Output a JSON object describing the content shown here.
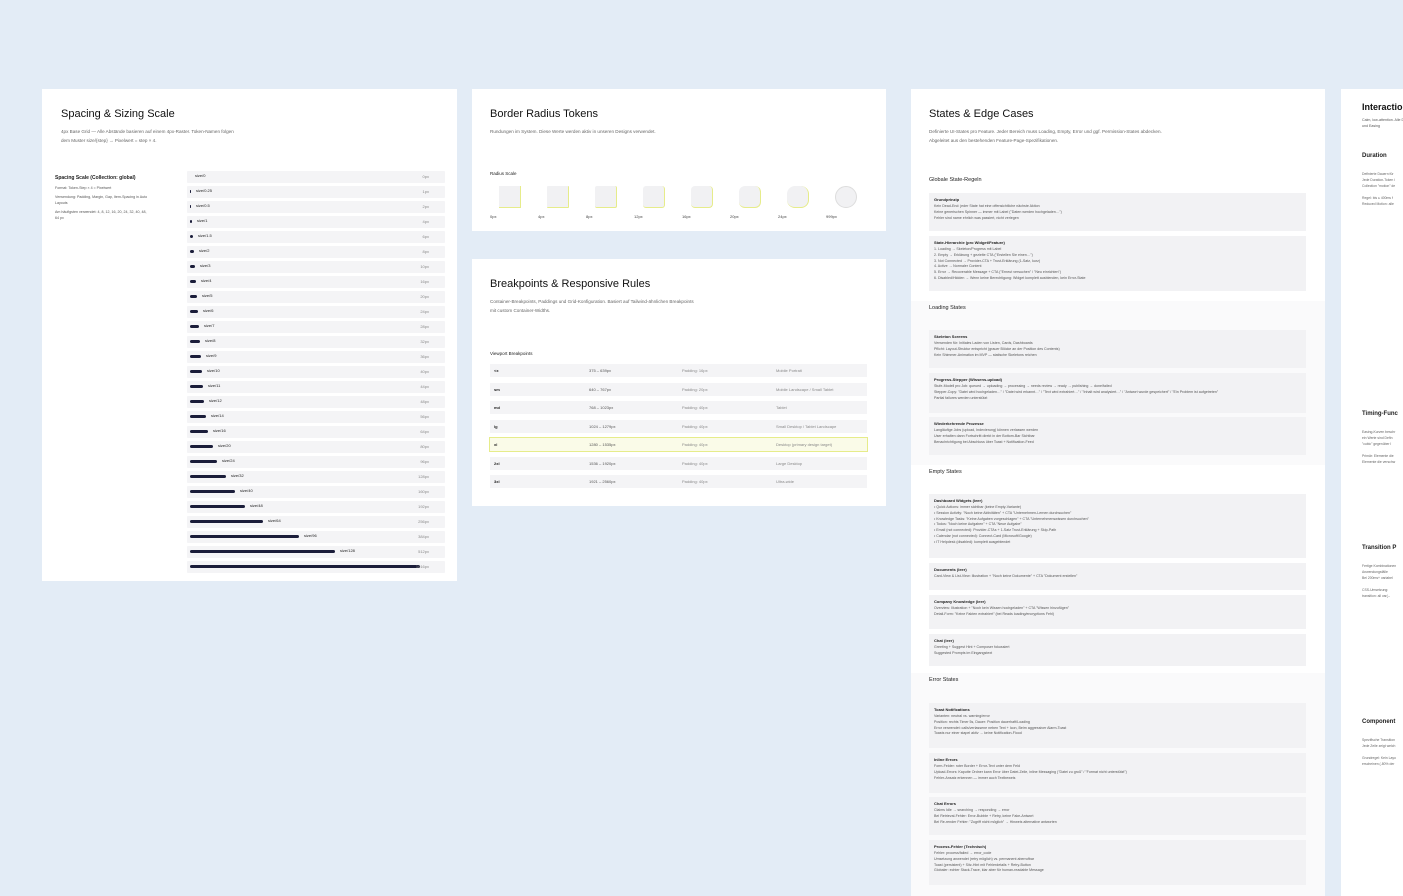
{
  "spacing": {
    "title": "Spacing & Sizing Scale",
    "desc": "4px Base Grid — Alle Abstände basieren auf einem 4px-Raster. Token-Namen folgen dem Muster size/{step} → Pixelwert = step × 4.",
    "side_title": "Spacing Scale (Collection: global)",
    "side_lines": [
      "Format: Token-Step × 4 = Pixelwert",
      "Verwendung: Padding, Margin, Gap, Item-Spacing in Auto Layouts",
      "Am häufigsten verwendet: 4, 8, 12, 16, 20, 24, 32, 40, 48, 64 px"
    ],
    "rows": [
      {
        "name": "size/0",
        "value": "0px"
      },
      {
        "name": "size/0.25",
        "value": "1px"
      },
      {
        "name": "size/0.5",
        "value": "2px"
      },
      {
        "name": "size/1",
        "value": "4px"
      },
      {
        "name": "size/1.5",
        "value": "6px"
      },
      {
        "name": "size/2",
        "value": "8px"
      },
      {
        "name": "size/3",
        "value": "10px"
      },
      {
        "name": "size/4",
        "value": "16px"
      },
      {
        "name": "size/5",
        "value": "20px"
      },
      {
        "name": "size/6",
        "value": "24px"
      },
      {
        "name": "size/7",
        "value": "28px"
      },
      {
        "name": "size/8",
        "value": "32px"
      },
      {
        "name": "size/9",
        "value": "36px"
      },
      {
        "name": "size/10",
        "value": "40px"
      },
      {
        "name": "size/11",
        "value": "44px"
      },
      {
        "name": "size/12",
        "value": "48px"
      },
      {
        "name": "size/14",
        "value": "56px"
      },
      {
        "name": "size/16",
        "value": "64px"
      },
      {
        "name": "size/20",
        "value": "80px"
      },
      {
        "name": "size/24",
        "value": "96px"
      },
      {
        "name": "size/32",
        "value": "128px"
      },
      {
        "name": "size/40",
        "value": "160px"
      },
      {
        "name": "size/48",
        "value": "192px"
      },
      {
        "name": "size/64",
        "value": "256px"
      },
      {
        "name": "size/96",
        "value": "384px"
      },
      {
        "name": "size/128",
        "value": "512px"
      },
      {
        "name": "",
        "value": "1016px"
      }
    ],
    "bar_fill": "#1b1d3a"
  },
  "radius": {
    "title": "Border Radius Tokens",
    "desc": "Rundungen im System. Diese Werte werden aktiv in unseren Designs verwendet.",
    "scale_label": "Radius Scale",
    "items": [
      {
        "label": "0px"
      },
      {
        "label": "4px"
      },
      {
        "label": "8px"
      },
      {
        "label": "12px"
      },
      {
        "label": "16px"
      },
      {
        "label": "20px"
      },
      {
        "label": "24px"
      },
      {
        "label": "999px"
      }
    ]
  },
  "breakpoints": {
    "title": "Breakpoints & Responsive Rules",
    "desc": "Container-Breakpoints, Paddings und Grid-Konfiguration. Basiert auf Tailwind-ähnlichen Breakpoints mit custom Container-Widths.",
    "table_label": "Viewport Breakpoints",
    "rows": [
      {
        "name": "<x",
        "range": "375 – 639px",
        "padding": "Padding: 16px",
        "use": "Mobile Portrait"
      },
      {
        "name": "sm",
        "range": "640 – 767px",
        "padding": "Padding: 20px",
        "use": "Mobile Landscape / Small Tablet"
      },
      {
        "name": "md",
        "range": "768 – 1023px",
        "padding": "Padding: 40px",
        "use": "Tablet"
      },
      {
        "name": "lg",
        "range": "1024 – 1279px",
        "padding": "Padding: 40px",
        "use": "Small Desktop / Tablet Landscape"
      },
      {
        "name": "xl",
        "range": "1280 – 1535px",
        "padding": "Padding: 40px",
        "use": "Desktop (primary design target)"
      },
      {
        "name": "2xl",
        "range": "1536 – 1920px",
        "padding": "Padding: 40px",
        "use": "Large Desktop"
      },
      {
        "name": "3xl",
        "range": "1921 – 2560px",
        "padding": "Padding: 40px",
        "use": "Ultra-wide"
      }
    ]
  },
  "states": {
    "title": "States & Edge Cases",
    "desc": "Definierte UI-States pro Feature. Jeder Bereich muss Loading, Empty, Error und ggf. Permission-States abdecken. Abgeleitet aus den bestehenden Feature-Page-Spezifikationen.",
    "sections": [
      {
        "title": "Globale State-Regeln",
        "blocks": [
          {
            "title": "Grundprinzip",
            "body": "Kein Dead-End: jeder State hat eine offensichtliche nächste Aktion\nKeine generischen Spinner — immer mit Label (\"Daten werden hochgeladen…\")\nFehler sind name ehrlich was passiert, nicht verlegen"
          },
          {
            "title": "State-Hierarchie (pro Widget/Feature)",
            "body": "1. Loading → Skeleton/Progress mit Label\n2. Empty → Erklärung + gezielte CTA (\"Erstellen Sie einen…\")\n3. Not Connected → Provider-CTA + Trust-Erklärung (1-Satz, kurz)\n4. Active → Normaler Content\n5. Error → Recoverable Message + CTA (\"Erneut versuchen\" / \"Neu einrichten\")\n6. Disabled/Hidden → Wenn keine Berechtigung: Widget komplett ausblenden, kein Error-State"
          }
        ]
      },
      {
        "title": "Loading States",
        "blocks": [
          {
            "title": "Skeleton Screens",
            "body": "Verwenden für: Initiales Laden von Listen, Cards, Dashboards\nPflicht: Layout-Struktur entspricht (grauer Blöcke an der Position des Contents)\nKein Shimmer-Animation im MVP — statische Skeletons reichen"
          },
          {
            "title": "Progress-Stepper (Wissens-upload)",
            "body": "Stufe-Modell pro Job: queued → uploading → processing → needs review → ready → publishing → done/failed\nStepper-Copy: \"Datei wird hochgeladen…\" / \"Datei wird erkannt…\" / \"Text wird extrahiert…\" / \"Inhalt wird analysiert…\" / \"Antwort wurde gespeichert\" / \"Ein Problem ist aufgetreten\"\nPartial failures werden unterstützt"
          },
          {
            "title": "Wiederkehrende Prozesse",
            "body": "Langläufige Jobs (upload, Indexierung) können verlassen werden\nUser erhalten dann Fortschritt direkt in der Bottom-Bar Sichtbar\nBenachrichtigung bei Abschluss über Toast + Notification-Feed"
          }
        ]
      },
      {
        "title": "Empty States",
        "blocks": [
          {
            "title": "Dashboard Widgets (leer)",
            "body": "• Quick Actions: immer sichtbar (keine Empty-Variante)\n• Session Activity: \"Noch keine Aktivitäten\" + CTA \"Unternehmen-Lernen durchsuchen\"\n• Knowledge Tasks: \"Keine Aufgaben vorgeschlagen\" + CTA \"Unternehmenswissen durchsuchen\"\n• Todos: \"Noch keine Aufgaben\" + CTA \"Neue Aufgabe\"\n• Email (not connected): Provider-CTAs + 1-Satz Trust-Erklärung + Skip-Path\n• Calendar (not connected): Connect-Card (Microsoft/Google)\n• IT Helpdesk (disabled): komplett ausgeblendet"
          },
          {
            "title": "Documents (leer)",
            "body": "Card-View & List-View: Illustration + \"Noch keine Dokumente\" + CTA \"Dokument erstellen\""
          },
          {
            "title": "Company Knowledge (leer)",
            "body": "Overview: Illustration + \"Noch kein Wissen hochgeladen\" + CTA \"Wissen hinzufügen\"\nDetail-Form: \"Keine Fakten extrahiert\" (bei Reads loading/encryptions Fehl)"
          },
          {
            "title": "Chat (leer)",
            "body": "Greeting + Suggest Hint + Composer fokussiert\nSuggested Prompts im Eingangstext"
          }
        ]
      },
      {
        "title": "Error States",
        "blocks": [
          {
            "title": "Toast Notifications",
            "body": "Varianten: neutral vs. warning/error\nPosition: rechts Timer 5s, Dauer: Position dauerhaft/Loading\nError verwendet: calls/verlassene neben Text + Icon, Beim aggressiver Alarm-Toast\nToasts nur einer stapel aktiv → keine Notification-Flood"
          },
          {
            "title": "Inline Errors",
            "body": "Form-Felder: roter Border + Error-Text unter dem Feld\nUpload-Errors: Kaputte Ordner kann Error über Datei-Zeile, inline Messaging (\"Datei zu groß\" / \"Format nicht unterstützt\")\nFehler-Ansatz erkennen — immer auch Textbeweis"
          },
          {
            "title": "Chat Errors",
            "body": "Claims Idle → searching → responding → error\nBei Retrieval-Fehler: Error-Bubble + Retry, keine Fake-Antwort\nBei Re-render Fehler: \"Zugriff nicht möglich\" → Hinweis alternative antworten"
          },
          {
            "title": "Process-Fehler (Technisch)",
            "body": "Fehler: process/failed → error_code\nUmsetzung anwendet (retry möglich) vs. permanent aberrufbar\nToast (persistent) + Sitz-Hint mit Fehlerdetails + Retry-Button\nGlobaler: echter Stack-Trace, klar aber für human-readable Message"
          }
        ]
      }
    ]
  },
  "interaction": {
    "title": "Interactio",
    "desc": "Calm, low-attention. Alle Duration- und Easing",
    "sections": [
      {
        "title": "Duration",
        "lines": [
          "Definierte Dauern für",
          "Jede Duration-Token i",
          "Collection \"motion\" de",
          "",
          "Regel: bis ≤ 400ms f",
          "Reduced Motion: alle"
        ]
      },
      {
        "title": "Timing-Func",
        "lines": [
          "Easing-Kurven beschr",
          "ein Werte sind Defin",
          "\"cubic\" gegenüber I",
          "",
          "Primär: Elemente die",
          "Elemente die verschw"
        ]
      },
      {
        "title": "Transition P",
        "lines": [
          "Fertige Kombinationen",
          "Anwendungsfälle",
          "Bei 200ms+ variabel",
          "",
          "CSS-Umsetzung:",
          "transition: all var(--"
        ]
      },
      {
        "title": "Component",
        "lines": [
          "Spezifische Transition",
          "Jede Zeile zeigt welch",
          "",
          "Grundregel: Kein Layo",
          "erscheinen (-80% der"
        ]
      }
    ]
  }
}
